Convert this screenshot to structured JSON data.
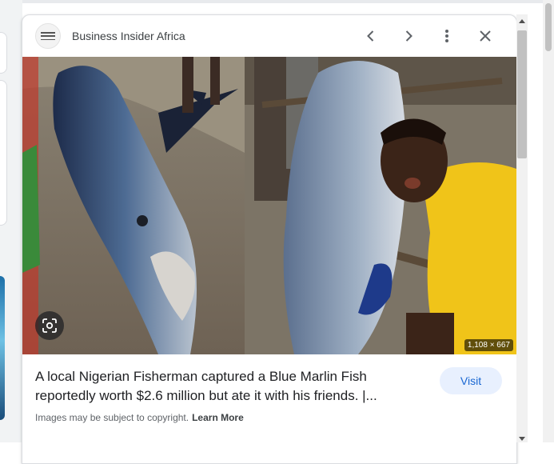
{
  "panel": {
    "source_name": "Business Insider Africa",
    "logo_icon": "business-insider-logo",
    "icons": {
      "prev": "chevron-left-icon",
      "next": "chevron-right-icon",
      "more": "more-vert-icon",
      "close": "close-icon",
      "lens": "google-lens-icon"
    },
    "image_dimensions": "1,108 × 667",
    "title": "A local Nigerian Fisherman captured a Blue Marlin Fish reportedly worth $2.6 million but ate it with his friends. |...",
    "visit_label": "Visit",
    "copyright_text": "Images may be subject to copyright.",
    "learn_more_label": "Learn More"
  },
  "colors": {
    "accent": "#1967d2",
    "visit_bg": "#e8f0fe"
  }
}
